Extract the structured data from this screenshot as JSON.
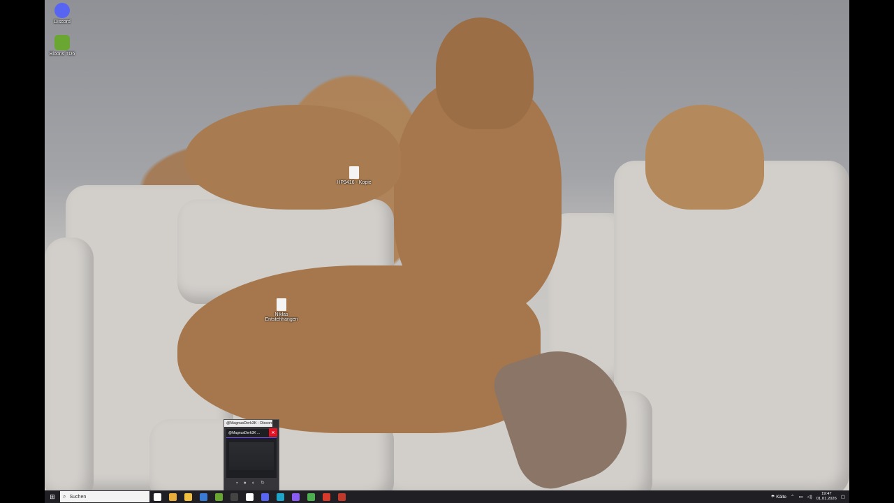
{
  "desktop_icons": [
    {
      "label": "Discord",
      "icon": "discord-icon",
      "color": "#5865F2"
    },
    {
      "label": "Bloons TD6",
      "icon": "bloons-td6-icon",
      "color": "#6aa632"
    },
    {
      "label": "HP9416 - Kopie",
      "icon": "document-file-icon",
      "color": "#f4f4f4"
    },
    {
      "label": "Niklas Entstehhangen",
      "icon": "document-file-icon",
      "color": "#f4f4f4"
    }
  ],
  "thumbnail": {
    "title": "@MagnusDerk3K - Discord",
    "inner_header": "@MagnusDerk3K ...",
    "close_glyph": "×"
  },
  "taskbar": {
    "start_icon": "windows-start-icon",
    "search_placeholder": "Suchen",
    "apps": [
      {
        "name": "task-view-icon",
        "color": "#ffffff"
      },
      {
        "name": "chrome-icon",
        "color": "#e8b03a"
      },
      {
        "name": "file-explorer-icon",
        "color": "#f0c040"
      },
      {
        "name": "app-blue-icon",
        "color": "#3a7bd5"
      },
      {
        "name": "app-green-icon",
        "color": "#6aa632"
      },
      {
        "name": "app-dark-icon",
        "color": "#444444"
      },
      {
        "name": "capcut-icon",
        "color": "#ffffff"
      },
      {
        "name": "discord-taskbar-icon",
        "color": "#5865F2"
      },
      {
        "name": "edge-icon",
        "color": "#1fa5c9"
      },
      {
        "name": "app-purple-icon",
        "color": "#8a5cf5"
      },
      {
        "name": "minecraft-icon",
        "color": "#4caf50"
      },
      {
        "name": "app-red-icon",
        "color": "#d83b2b"
      },
      {
        "name": "app-screen-icon",
        "color": "#c0392b"
      }
    ],
    "weather": "Kälte",
    "time": "19:47",
    "date": "01.01.2026"
  }
}
